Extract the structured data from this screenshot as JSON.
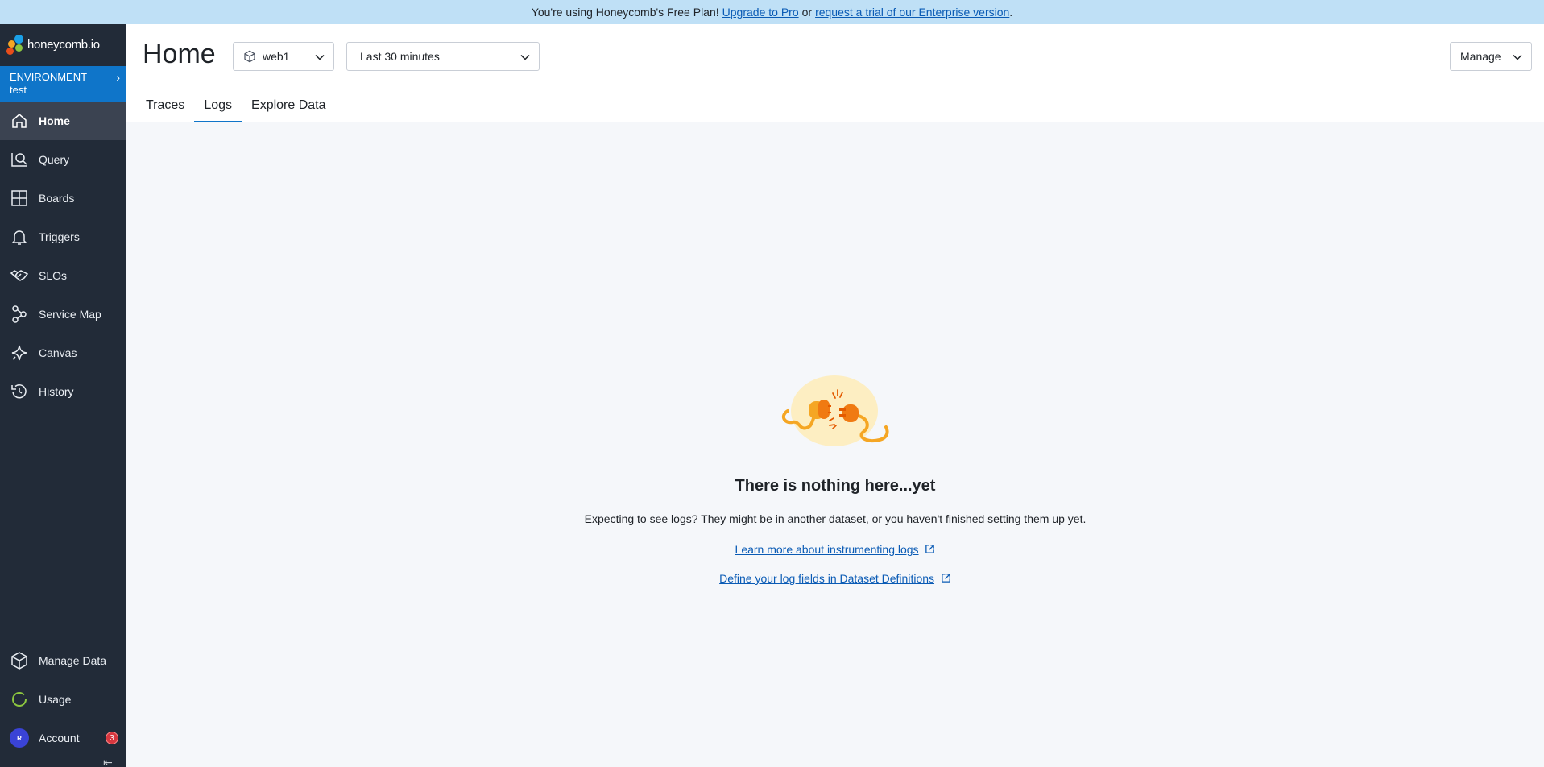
{
  "banner": {
    "prefix": "You're using Honeycomb's Free Plan!",
    "upgrade_link": "Upgrade to Pro",
    "middle": "or",
    "trial_link": "request a trial of our Enterprise version",
    "suffix": "."
  },
  "logo": {
    "text": "honeycomb.io"
  },
  "environment": {
    "label": "ENVIRONMENT",
    "name": "test"
  },
  "sidebar": {
    "items": [
      {
        "label": "Home",
        "icon": "home-icon",
        "active": true
      },
      {
        "label": "Query",
        "icon": "query-icon"
      },
      {
        "label": "Boards",
        "icon": "boards-icon"
      },
      {
        "label": "Triggers",
        "icon": "bell-icon"
      },
      {
        "label": "SLOs",
        "icon": "handshake-icon"
      },
      {
        "label": "Service Map",
        "icon": "service-map-icon"
      },
      {
        "label": "Canvas",
        "icon": "sparkle-icon"
      },
      {
        "label": "History",
        "icon": "history-icon"
      }
    ],
    "bottom": [
      {
        "label": "Manage Data",
        "icon": "cube-icon"
      },
      {
        "label": "Usage",
        "icon": "usage-ring-icon"
      },
      {
        "label": "Account",
        "avatar": "R",
        "badge": "3"
      }
    ]
  },
  "header": {
    "title": "Home",
    "dataset": "web1",
    "time_range": "Last 30 minutes",
    "manage_label": "Manage",
    "tabs": [
      {
        "label": "Traces"
      },
      {
        "label": "Logs",
        "active": true
      },
      {
        "label": "Explore Data"
      }
    ]
  },
  "empty_state": {
    "title": "There is nothing here...yet",
    "description": "Expecting to see logs? They might be in another dataset, or you haven't finished setting them up yet.",
    "link_learn": "Learn more about instrumenting logs",
    "link_define": "Define your log fields in Dataset Definitions"
  },
  "colors": {
    "sidebar_bg": "#222b38",
    "environment_bg": "#0f75c9",
    "banner_bg": "#bfe0f6",
    "link": "#0a5bb5",
    "badge": "#d7373f"
  }
}
